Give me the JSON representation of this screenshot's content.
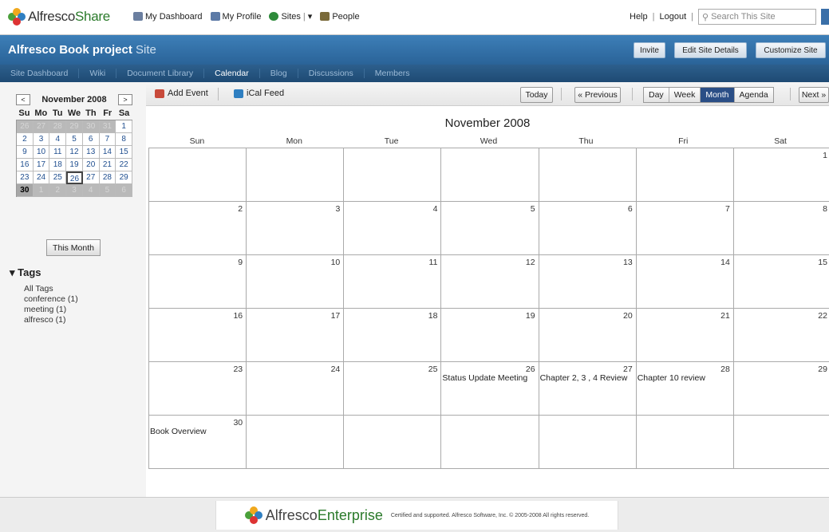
{
  "header": {
    "logo_text": "Alfresco",
    "logo_text2": "Share",
    "nav": [
      {
        "label": "My Dashboard"
      },
      {
        "label": "My Profile"
      },
      {
        "label": "Sites"
      },
      {
        "label": "People"
      }
    ],
    "help": "Help",
    "logout": "Logout",
    "search_placeholder": "Search This Site"
  },
  "site": {
    "title": "Alfresco Book project",
    "title_suffix": "Site",
    "buttons": [
      "Invite",
      "Edit Site Details",
      "Customize Site"
    ],
    "tabs": [
      "Site Dashboard",
      "Wiki",
      "Document Library",
      "Calendar",
      "Blog",
      "Discussions",
      "Members"
    ],
    "active_tab": "Calendar"
  },
  "mini_calendar": {
    "title": "November 2008",
    "prev": "<",
    "next": ">",
    "dow": [
      "Su",
      "Mo",
      "Tu",
      "We",
      "Th",
      "Fr",
      "Sa"
    ],
    "weeks": [
      [
        "26",
        "27",
        "28",
        "29",
        "30",
        "31",
        "1"
      ],
      [
        "2",
        "3",
        "4",
        "5",
        "6",
        "7",
        "8"
      ],
      [
        "9",
        "10",
        "11",
        "12",
        "13",
        "14",
        "15"
      ],
      [
        "16",
        "17",
        "18",
        "19",
        "20",
        "21",
        "22"
      ],
      [
        "23",
        "24",
        "25",
        "26",
        "27",
        "28",
        "29"
      ],
      [
        "30",
        "1",
        "2",
        "3",
        "4",
        "5",
        "6"
      ]
    ],
    "this_month": "This Month"
  },
  "tags": {
    "title": "Tags",
    "items": [
      "All Tags",
      "conference (1)",
      "meeting (1)",
      "alfresco (1)"
    ]
  },
  "toolbar": {
    "add_event": "Add Event",
    "ical": "iCal Feed",
    "today": "Today",
    "previous": "« Previous",
    "views": [
      "Day",
      "Week",
      "Month",
      "Agenda"
    ],
    "active_view": "Month",
    "next": "Next »"
  },
  "calendar": {
    "title": "November 2008",
    "dow": [
      "Sun",
      "Mon",
      "Tue",
      "Wed",
      "Thu",
      "Fri",
      "Sat"
    ],
    "weeks": [
      [
        "",
        "",
        "",
        "",
        "",
        "",
        "1"
      ],
      [
        "2",
        "3",
        "4",
        "5",
        "6",
        "7",
        "8"
      ],
      [
        "9",
        "10",
        "11",
        "12",
        "13",
        "14",
        "15"
      ],
      [
        "16",
        "17",
        "18",
        "19",
        "20",
        "21",
        "22"
      ],
      [
        "23",
        "24",
        "25",
        "26",
        "27",
        "28",
        "29"
      ],
      [
        "30",
        "",
        "",
        "",
        "",
        "",
        ""
      ]
    ],
    "events": {
      "26": "Status Update Meeting",
      "27": "Chapter 2, 3 , 4 Review",
      "28": "Chapter 10 review",
      "30": "Book Overview"
    }
  },
  "footer": {
    "brand": "Alfresco",
    "brand2": "Enterprise",
    "copyright": "Certified and supported. Alfresco Software, Inc. © 2005-2008 All rights reserved."
  },
  "colors": {
    "site_bar": "#2f6ea5",
    "subnav": "#23527e",
    "active_view": "#2a4e86"
  }
}
